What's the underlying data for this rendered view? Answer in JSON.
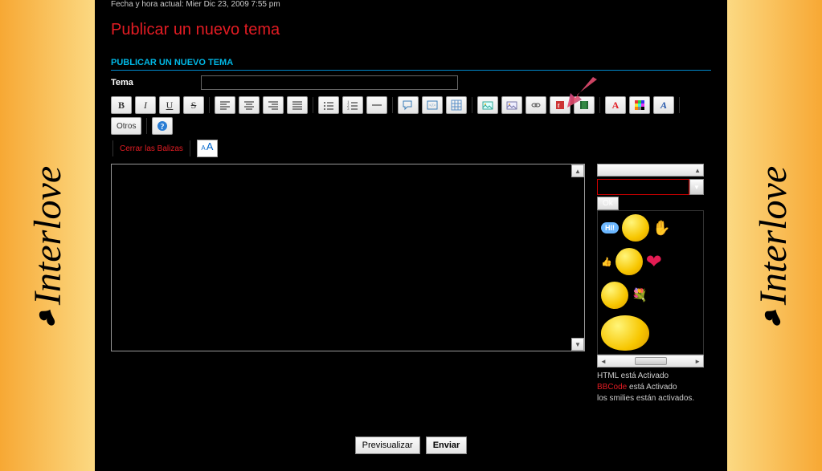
{
  "sideBrand": "Interlove",
  "timestamp": "Fecha y hora actual: Mier Dic 23, 2009 7:55 pm",
  "pageTitle": "Publicar un nuevo tema",
  "sectionHeader": "PUBLICAR UN NUEVO TEMA",
  "temaLabel": "Tema",
  "temaValue": "",
  "closeTags": "Cerrar las Balizas",
  "otrosLabel": "Otros",
  "okLabel": "Ok",
  "hiLabel": "HI!",
  "status": {
    "htmlLine": "HTML está Activado",
    "bbcodeLabel": "BBCode",
    "bbcodeRest": " está Activado",
    "smiliesLine": "los smilies están activados."
  },
  "buttons": {
    "preview": "Previsualizar",
    "send": "Enviar"
  },
  "fmt": {
    "b": "B",
    "i": "I",
    "u": "U",
    "s": "S"
  }
}
